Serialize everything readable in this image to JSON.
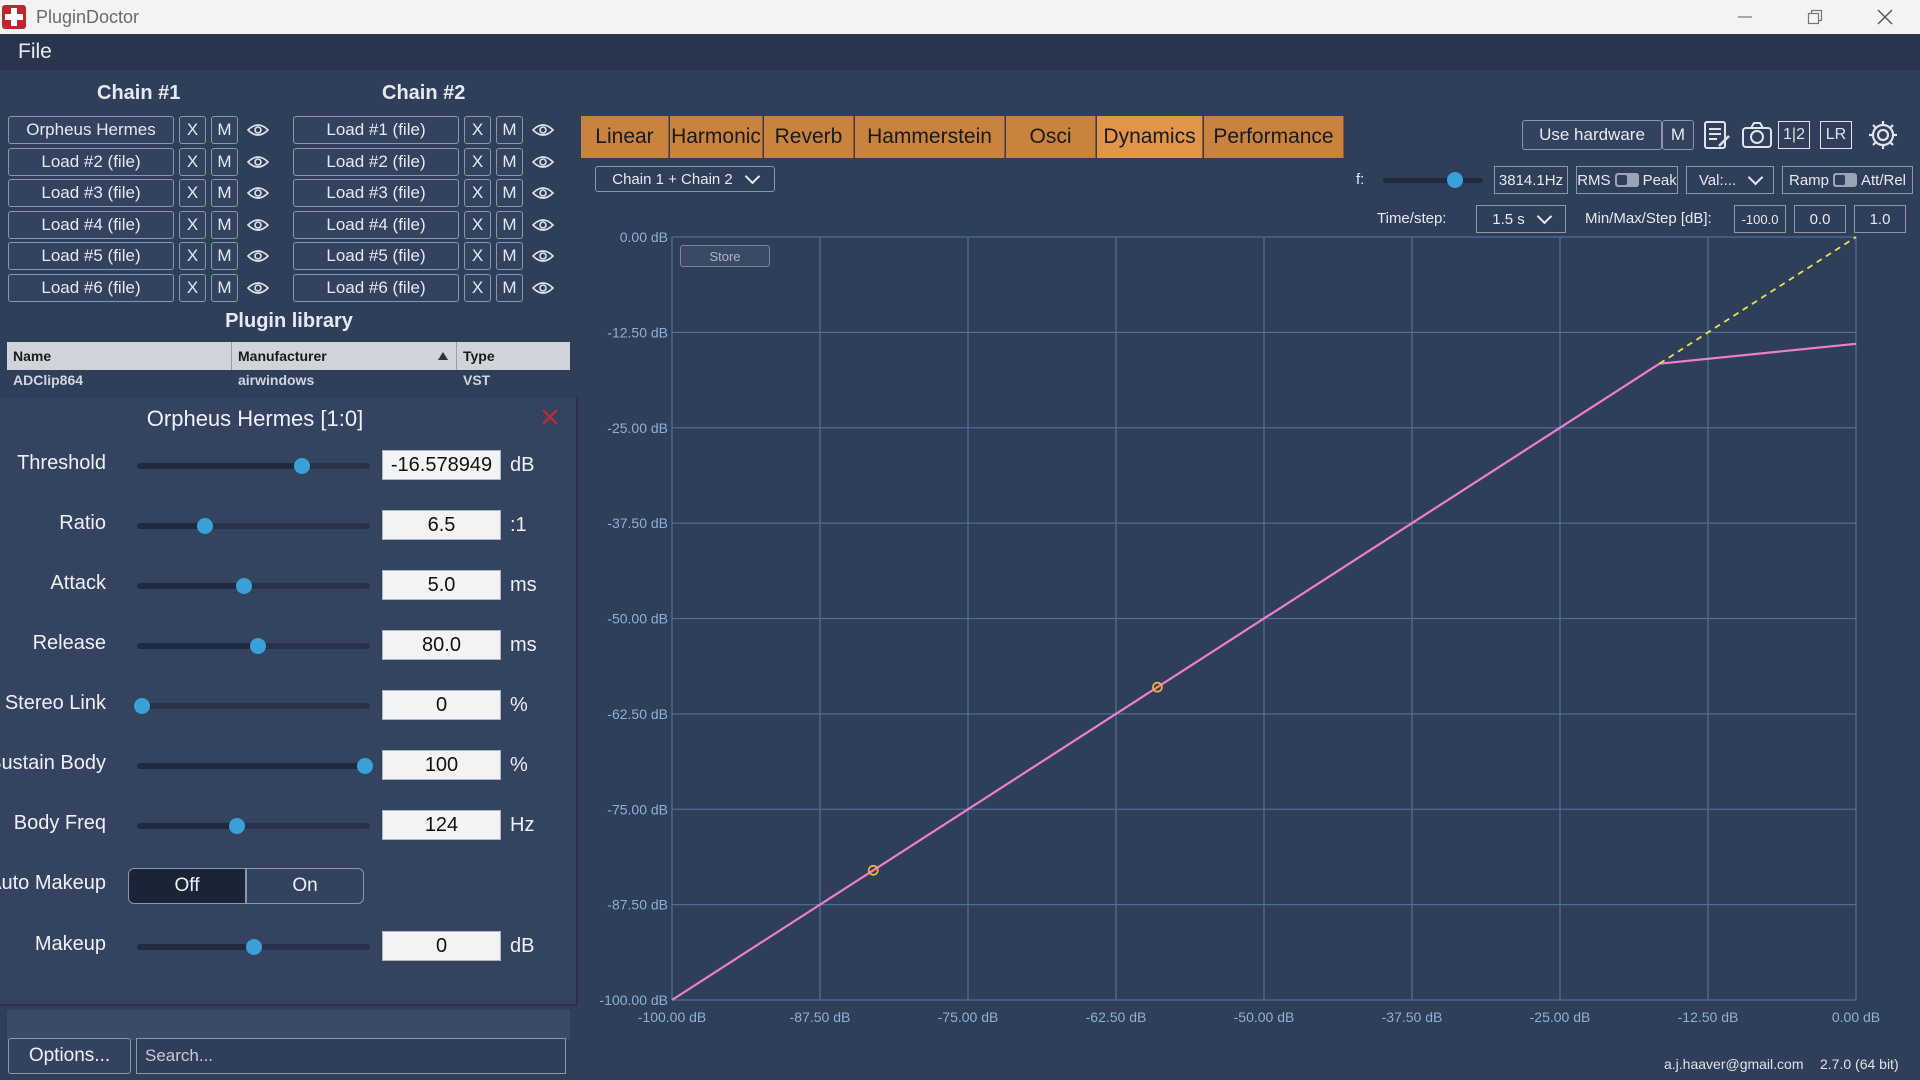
{
  "window": {
    "title": "PluginDoctor"
  },
  "menu": {
    "file": "File"
  },
  "chains": [
    {
      "title": "Chain #1",
      "slots": [
        "Orpheus Hermes",
        "Load #2 (file)",
        "Load #3 (file)",
        "Load #4 (file)",
        "Load #5 (file)",
        "Load #6 (file)"
      ]
    },
    {
      "title": "Chain #2",
      "slots": [
        "Load #1 (file)",
        "Load #2 (file)",
        "Load #3 (file)",
        "Load #4 (file)",
        "Load #5 (file)",
        "Load #6 (file)"
      ]
    }
  ],
  "slot_buttons": {
    "remove": "X",
    "mute": "M"
  },
  "plugin_library": {
    "title": "Plugin library",
    "columns": [
      "Name",
      "Manufacturer",
      "Type"
    ],
    "rows": [
      {
        "name": "ADClip864",
        "manufacturer": "airwindows",
        "type": "VST"
      }
    ]
  },
  "editor": {
    "title": "Orpheus Hermes [1:0]",
    "params": [
      {
        "label": "Threshold",
        "value": "-16.578949",
        "unit": "dB",
        "position": 0.71
      },
      {
        "label": "Ratio",
        "value": "6.5",
        "unit": ":1",
        "position": 0.29
      },
      {
        "label": "Attack",
        "value": "5.0",
        "unit": "ms",
        "position": 0.46
      },
      {
        "label": "Release",
        "value": "80.0",
        "unit": "ms",
        "position": 0.52
      },
      {
        "label": "Stereo Link",
        "value": "0",
        "unit": "%",
        "position": 0.02
      },
      {
        "label": "Sustain Body",
        "value": "100",
        "unit": "%",
        "position": 0.98
      },
      {
        "label": "Body Freq",
        "value": "124",
        "unit": "Hz",
        "position": 0.43
      }
    ],
    "auto_makeup": {
      "label": "Auto Makeup",
      "off": "Off",
      "on": "On",
      "selected": "Off"
    },
    "makeup": {
      "label": "Makeup",
      "value": "0",
      "unit": "dB",
      "position": 0.5
    }
  },
  "bottom": {
    "options": "Options...",
    "search_placeholder": "Search..."
  },
  "tabs": [
    "Linear",
    "Harmonic",
    "Reverb",
    "Hammerstein",
    "Osci",
    "Dynamics",
    "Performance"
  ],
  "active_tab": "Dynamics",
  "toolbar": {
    "use_hardware": "Use hardware",
    "mute": "M",
    "channels": "1|2",
    "lr": "LR"
  },
  "controls": {
    "chain_select": "Chain 1 + Chain 2",
    "freq_label": "f:",
    "freq_value": "3814.1Hz",
    "freq_position": 0.72,
    "rms": "RMS",
    "peak": "Peak",
    "value_select": "Val:...",
    "ramp": "Ramp",
    "att_rel": "Att/Rel",
    "time_step_label": "Time/step:",
    "time_step_value": "1.5 s",
    "minmax_label": "Min/Max/Step [dB]:",
    "min": "-100.0",
    "max": "0.0",
    "step": "1.0"
  },
  "store_label": "Store",
  "chart_data": {
    "type": "line",
    "xlim": [
      -100,
      0
    ],
    "ylim": [
      -100,
      0
    ],
    "x_ticks": [
      "-100.00 dB",
      "-87.50 dB",
      "-75.00 dB",
      "-62.50 dB",
      "-50.00 dB",
      "-37.50 dB",
      "-25.00 dB",
      "-12.50 dB",
      "0.00 dB"
    ],
    "y_ticks": [
      "0.00 dB",
      "-12.50 dB",
      "-25.00 dB",
      "-37.50 dB",
      "-50.00 dB",
      "-62.50 dB",
      "-75.00 dB",
      "-87.50 dB",
      "-100.00 dB"
    ],
    "grid": true,
    "series": [
      {
        "style": "solid",
        "color": "#ee7fd0",
        "x": [
          -100,
          -16.6,
          0
        ],
        "y": [
          -100,
          -16.6,
          -14.0
        ]
      },
      {
        "style": "dashed",
        "color": "#e6e64a",
        "x": [
          -16.6,
          0
        ],
        "y": [
          -16.6,
          0
        ]
      }
    ],
    "markers": [
      {
        "x": -83,
        "y": -83
      },
      {
        "x": -59,
        "y": -59
      }
    ],
    "colors": {
      "grid": "#4f6d96",
      "marker": "#f0b030"
    }
  },
  "footer": {
    "email": "a.j.haaver@gmail.com",
    "version": "2.7.0 (64 bit)"
  }
}
